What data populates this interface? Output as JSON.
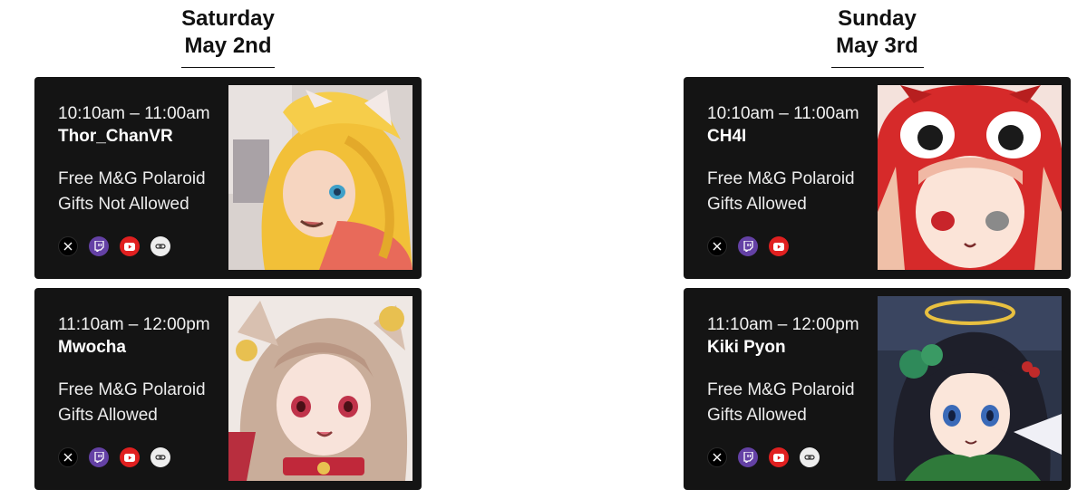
{
  "days": [
    {
      "day": "Saturday",
      "date": "May 2nd",
      "slots": [
        {
          "time": "10:10am – 11:00am",
          "name": "Thor_ChanVR",
          "perk1": "Free M&G Polaroid",
          "perk2": "Gifts Not Allowed",
          "socials": [
            "x-icon",
            "twitch-icon",
            "youtube-icon",
            "link-icon"
          ]
        },
        {
          "time": "11:10am – 12:00pm",
          "name": "Mwocha",
          "perk1": "Free M&G Polaroid",
          "perk2": "Gifts Allowed",
          "socials": [
            "x-icon",
            "twitch-icon",
            "youtube-icon",
            "link-icon"
          ]
        }
      ]
    },
    {
      "day": "Sunday",
      "date": "May 3rd",
      "slots": [
        {
          "time": "10:10am – 11:00am",
          "name": "CH4I",
          "perk1": "Free M&G Polaroid",
          "perk2": "Gifts Allowed",
          "socials": [
            "x-icon",
            "twitch-icon",
            "youtube-icon"
          ]
        },
        {
          "time": "11:10am – 12:00pm",
          "name": "Kiki Pyon",
          "perk1": "Free M&G Polaroid",
          "perk2": "Gifts Allowed",
          "socials": [
            "x-icon",
            "twitch-icon",
            "youtube-icon",
            "link-icon"
          ]
        }
      ]
    }
  ],
  "colors": {
    "card_bg": "#141414",
    "twitch": "#6441a5",
    "youtube": "#e02020",
    "link": "#eeeeee"
  }
}
